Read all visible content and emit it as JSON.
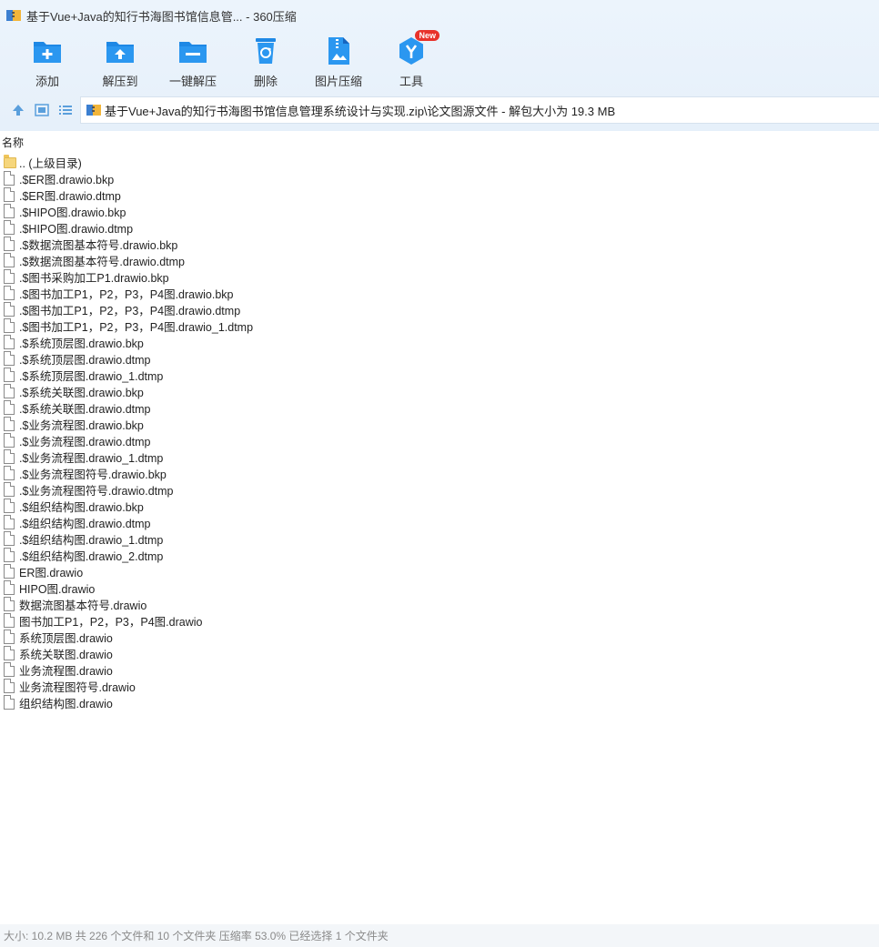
{
  "window": {
    "title": "基于Vue+Java的知行书海图书馆信息管... - 360压缩"
  },
  "toolbar": {
    "items": [
      {
        "label": "添加",
        "icon": "add-icon"
      },
      {
        "label": "解压到",
        "icon": "extract-to-icon"
      },
      {
        "label": "一键解压",
        "icon": "one-click-extract-icon"
      },
      {
        "label": "删除",
        "icon": "delete-icon"
      },
      {
        "label": "图片压缩",
        "icon": "image-compress-icon"
      },
      {
        "label": "工具",
        "icon": "tools-icon",
        "badge": "New"
      }
    ]
  },
  "address": {
    "path": "基于Vue+Java的知行书海图书馆信息管理系统设计与实现.zip\\论文图源文件 - 解包大小为 19.3 MB"
  },
  "list": {
    "column_header": "名称",
    "items": [
      {
        "name": ".. (上级目录)",
        "type": "folder"
      },
      {
        "name": ".$ER图.drawio.bkp",
        "type": "file"
      },
      {
        "name": ".$ER图.drawio.dtmp",
        "type": "file"
      },
      {
        "name": ".$HIPO图.drawio.bkp",
        "type": "file"
      },
      {
        "name": ".$HIPO图.drawio.dtmp",
        "type": "file"
      },
      {
        "name": ".$数据流图基本符号.drawio.bkp",
        "type": "file"
      },
      {
        "name": ".$数据流图基本符号.drawio.dtmp",
        "type": "file"
      },
      {
        "name": ".$图书采购加工P1.drawio.bkp",
        "type": "file"
      },
      {
        "name": ".$图书加工P1，P2，P3，P4图.drawio.bkp",
        "type": "file"
      },
      {
        "name": ".$图书加工P1，P2，P3，P4图.drawio.dtmp",
        "type": "file"
      },
      {
        "name": ".$图书加工P1，P2，P3，P4图.drawio_1.dtmp",
        "type": "file"
      },
      {
        "name": ".$系统顶层图.drawio.bkp",
        "type": "file"
      },
      {
        "name": ".$系统顶层图.drawio.dtmp",
        "type": "file"
      },
      {
        "name": ".$系统顶层图.drawio_1.dtmp",
        "type": "file"
      },
      {
        "name": ".$系统关联图.drawio.bkp",
        "type": "file"
      },
      {
        "name": ".$系统关联图.drawio.dtmp",
        "type": "file"
      },
      {
        "name": ".$业务流程图.drawio.bkp",
        "type": "file"
      },
      {
        "name": ".$业务流程图.drawio.dtmp",
        "type": "file"
      },
      {
        "name": ".$业务流程图.drawio_1.dtmp",
        "type": "file"
      },
      {
        "name": ".$业务流程图符号.drawio.bkp",
        "type": "file"
      },
      {
        "name": ".$业务流程图符号.drawio.dtmp",
        "type": "file"
      },
      {
        "name": ".$组织结构图.drawio.bkp",
        "type": "file"
      },
      {
        "name": ".$组织结构图.drawio.dtmp",
        "type": "file"
      },
      {
        "name": ".$组织结构图.drawio_1.dtmp",
        "type": "file"
      },
      {
        "name": ".$组织结构图.drawio_2.dtmp",
        "type": "file"
      },
      {
        "name": "ER图.drawio",
        "type": "file"
      },
      {
        "name": "HIPO图.drawio",
        "type": "file"
      },
      {
        "name": "数据流图基本符号.drawio",
        "type": "file"
      },
      {
        "name": "图书加工P1，P2，P3，P4图.drawio",
        "type": "file"
      },
      {
        "name": "系统顶层图.drawio",
        "type": "file"
      },
      {
        "name": "系统关联图.drawio",
        "type": "file"
      },
      {
        "name": "业务流程图.drawio",
        "type": "file"
      },
      {
        "name": "业务流程图符号.drawio",
        "type": "file"
      },
      {
        "name": "组织结构图.drawio",
        "type": "file"
      }
    ]
  },
  "status": {
    "text": "大小: 10.2 MB 共 226 个文件和 10 个文件夹 压缩率 53.0% 已经选择 1 个文件夹"
  },
  "colors": {
    "accent": "#1e88e5",
    "toolbar_bg": "#e6f0fa",
    "badge": "#e8322b",
    "folder": "#f6d67c"
  }
}
